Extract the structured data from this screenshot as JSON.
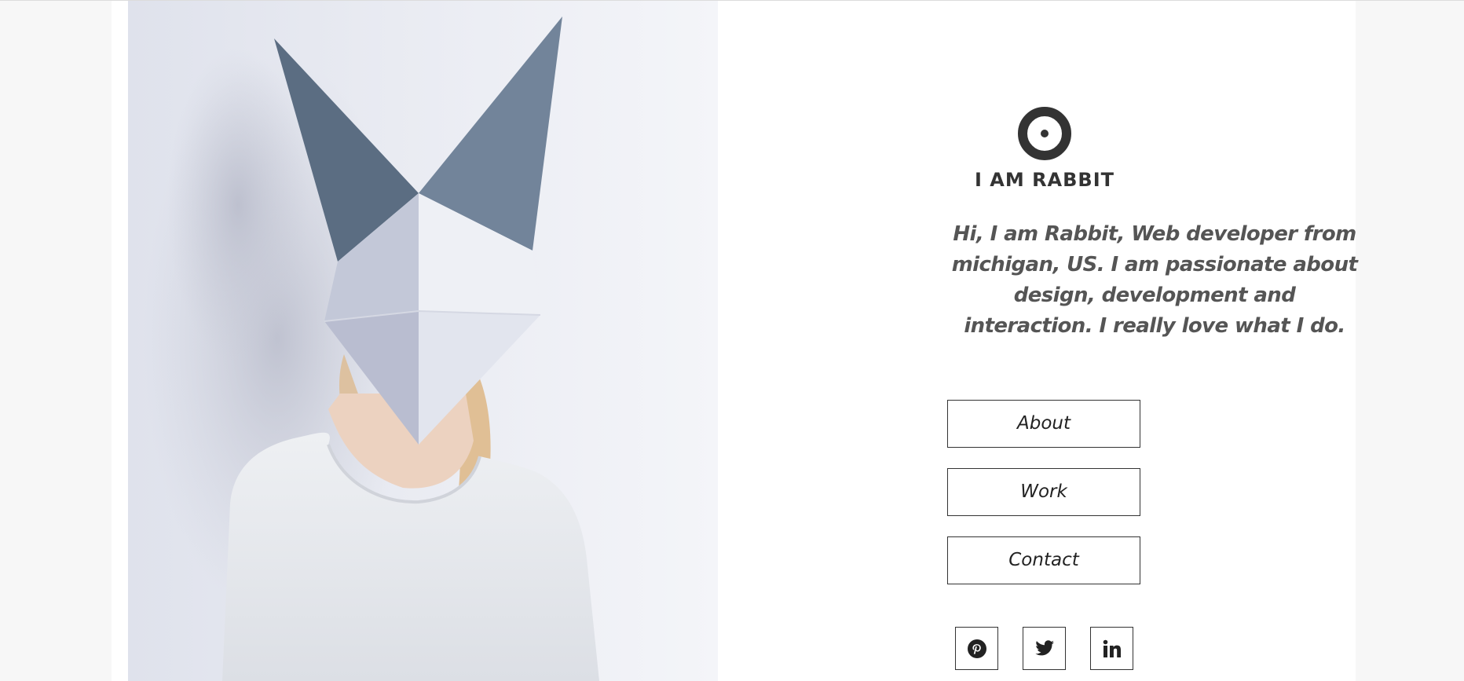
{
  "site": {
    "brand_name": "I AM RABBIT",
    "logo_icon": "circle-dot-icon",
    "intro_text": "Hi, I am Rabbit, Web developer from michigan, US. I am passionate about design, development and interaction. I really love what I do."
  },
  "nav": {
    "about_label": "About",
    "work_label": "Work",
    "contact_label": "Contact"
  },
  "social": [
    {
      "icon": "pinterest-icon"
    },
    {
      "icon": "twitter-icon"
    },
    {
      "icon": "linkedin-icon"
    }
  ],
  "colors": {
    "text_dark": "#333333",
    "intro_text": "#555555",
    "page_background": "#f7f7f7",
    "content_background": "#ffffff"
  }
}
